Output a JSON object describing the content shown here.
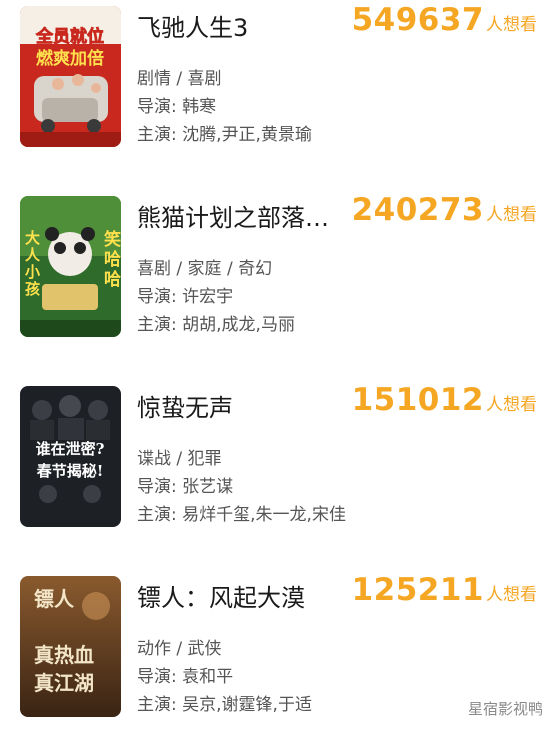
{
  "want_unit": "人想看",
  "movies": [
    {
      "title": "飞驰人生3",
      "want_count": "549637",
      "genre": "剧情 / 喜剧",
      "director": "导演: 韩寒",
      "cast": "主演: 沈腾,尹正,黄景瑜",
      "poster_text": [
        "全员就位",
        "燃爽加倍"
      ]
    },
    {
      "title": "熊猫计划之部落…",
      "want_count": "240273",
      "genre": "喜剧 / 家庭 / 奇幻",
      "director": "导演: 许宏宇",
      "cast": "主演: 胡胡,成龙,马丽",
      "poster_text": [
        "大人小孩",
        "笑哈哈"
      ]
    },
    {
      "title": "惊蛰无声",
      "want_count": "151012",
      "genre": "谍战 / 犯罪",
      "director": "导演: 张艺谋",
      "cast": "主演: 易烊千玺,朱一龙,宋佳",
      "poster_text": [
        "谁在泄密?",
        "春节揭秘!"
      ]
    },
    {
      "title": "镖人：风起大漠",
      "want_count": "125211",
      "genre": "动作 / 武侠",
      "director": "导演: 袁和平",
      "cast": "主演: 吴京,谢霆锋,于适",
      "poster_text": [
        "镖人",
        "真热血",
        "真江湖"
      ]
    }
  ],
  "watermark": "星宿影视鸭",
  "colors": {
    "want_count": "#f5a623",
    "title": "#1a1a1a",
    "meta": "#555555"
  }
}
